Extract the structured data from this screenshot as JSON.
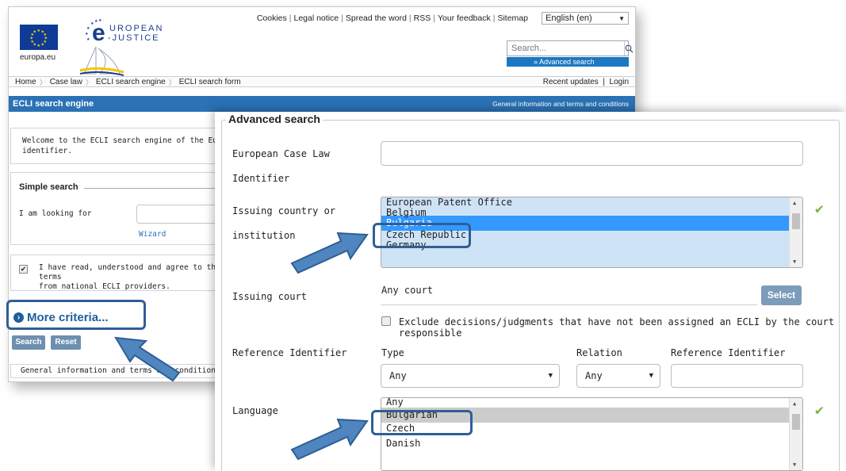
{
  "top_links": [
    "Cookies",
    "Legal notice",
    "Spread the word",
    "RSS",
    "Your feedback",
    "Sitemap"
  ],
  "language_select": {
    "value": "English (en)"
  },
  "logos": {
    "europa_label": "europa.eu",
    "ejustice_line1": "UROPEAN",
    "ejustice_line2": "-JUSTICE",
    "ejustice_e": "e"
  },
  "header_search": {
    "placeholder": "Search...",
    "advanced_link": "» Advanced search"
  },
  "breadcrumb": {
    "items": [
      "Home",
      "Case law",
      "ECLI search engine",
      "ECLI search form"
    ],
    "recent_updates": "Recent updates",
    "login": "Login",
    "divider": "|"
  },
  "engine_bar": {
    "title": "ECLI search engine",
    "right_link": "General information and terms and conditions"
  },
  "welcome": {
    "text_line1": "Welcome to the ECLI search engine of the Europea",
    "text_line2": "identifier."
  },
  "simple_search": {
    "title": "Simple search",
    "looking_label": "I am looking for",
    "wizard": "Wizard"
  },
  "agree": {
    "line1": "I have read, understood and agree to the terms",
    "line2": "from national ECLI providers."
  },
  "more_criteria": {
    "label": "More criteria...",
    "icon": "chevron-right-circle-icon"
  },
  "buttons": {
    "search": "Search",
    "reset": "Reset"
  },
  "footer": {
    "text": "General information and terms and conditions"
  },
  "advanced": {
    "title": "Advanced search",
    "ecli_label_1": "European Case Law",
    "ecli_label_2": "Identifier",
    "country_label_1": "Issuing country or",
    "country_label_2": "institution",
    "country_options": [
      "European Patent Office",
      "Belgium",
      "Bulgaria",
      "Czech Republic",
      "Germany"
    ],
    "country_selected": "Bulgaria",
    "court_label": "Issuing court",
    "court_value": "Any court",
    "select_button": "Select",
    "exclude_text": "Exclude decisions/judgments that have not been assigned an ECLI by the court responsible",
    "ref_label": "Reference Identifier",
    "type_label": "Type",
    "type_value": "Any",
    "relation_label": "Relation",
    "relation_value": "Any",
    "ref_id_label": "Reference Identifier",
    "language_label": "Language",
    "language_options": [
      "Any",
      "Bulgarian",
      "Czech",
      "Danish"
    ],
    "language_selected": "Bulgarian"
  },
  "colors": {
    "brand_blue": "#2a72b5",
    "highlight_blue": "#3399ff",
    "check_green": "#7cb342",
    "annotation_blue": "#2f5e95"
  }
}
